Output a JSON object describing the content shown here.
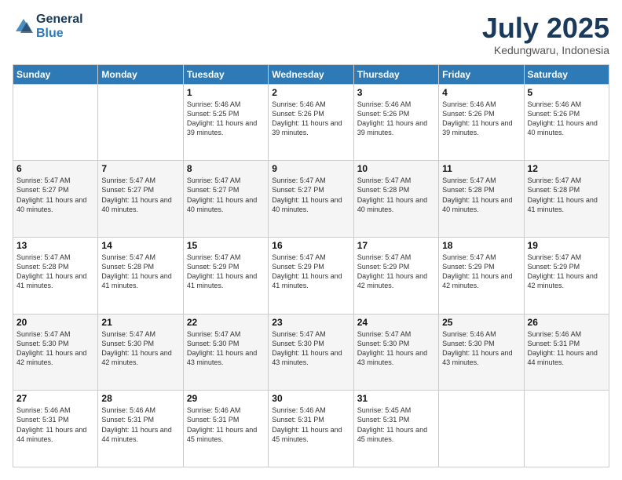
{
  "header": {
    "logo_line1": "General",
    "logo_line2": "Blue",
    "month": "July 2025",
    "location": "Kedungwaru, Indonesia"
  },
  "days_of_week": [
    "Sunday",
    "Monday",
    "Tuesday",
    "Wednesday",
    "Thursday",
    "Friday",
    "Saturday"
  ],
  "weeks": [
    [
      {
        "day": "",
        "info": ""
      },
      {
        "day": "",
        "info": ""
      },
      {
        "day": "1",
        "info": "Sunrise: 5:46 AM\nSunset: 5:25 PM\nDaylight: 11 hours and 39 minutes."
      },
      {
        "day": "2",
        "info": "Sunrise: 5:46 AM\nSunset: 5:26 PM\nDaylight: 11 hours and 39 minutes."
      },
      {
        "day": "3",
        "info": "Sunrise: 5:46 AM\nSunset: 5:26 PM\nDaylight: 11 hours and 39 minutes."
      },
      {
        "day": "4",
        "info": "Sunrise: 5:46 AM\nSunset: 5:26 PM\nDaylight: 11 hours and 39 minutes."
      },
      {
        "day": "5",
        "info": "Sunrise: 5:46 AM\nSunset: 5:26 PM\nDaylight: 11 hours and 40 minutes."
      }
    ],
    [
      {
        "day": "6",
        "info": "Sunrise: 5:47 AM\nSunset: 5:27 PM\nDaylight: 11 hours and 40 minutes."
      },
      {
        "day": "7",
        "info": "Sunrise: 5:47 AM\nSunset: 5:27 PM\nDaylight: 11 hours and 40 minutes."
      },
      {
        "day": "8",
        "info": "Sunrise: 5:47 AM\nSunset: 5:27 PM\nDaylight: 11 hours and 40 minutes."
      },
      {
        "day": "9",
        "info": "Sunrise: 5:47 AM\nSunset: 5:27 PM\nDaylight: 11 hours and 40 minutes."
      },
      {
        "day": "10",
        "info": "Sunrise: 5:47 AM\nSunset: 5:28 PM\nDaylight: 11 hours and 40 minutes."
      },
      {
        "day": "11",
        "info": "Sunrise: 5:47 AM\nSunset: 5:28 PM\nDaylight: 11 hours and 40 minutes."
      },
      {
        "day": "12",
        "info": "Sunrise: 5:47 AM\nSunset: 5:28 PM\nDaylight: 11 hours and 41 minutes."
      }
    ],
    [
      {
        "day": "13",
        "info": "Sunrise: 5:47 AM\nSunset: 5:28 PM\nDaylight: 11 hours and 41 minutes."
      },
      {
        "day": "14",
        "info": "Sunrise: 5:47 AM\nSunset: 5:28 PM\nDaylight: 11 hours and 41 minutes."
      },
      {
        "day": "15",
        "info": "Sunrise: 5:47 AM\nSunset: 5:29 PM\nDaylight: 11 hours and 41 minutes."
      },
      {
        "day": "16",
        "info": "Sunrise: 5:47 AM\nSunset: 5:29 PM\nDaylight: 11 hours and 41 minutes."
      },
      {
        "day": "17",
        "info": "Sunrise: 5:47 AM\nSunset: 5:29 PM\nDaylight: 11 hours and 42 minutes."
      },
      {
        "day": "18",
        "info": "Sunrise: 5:47 AM\nSunset: 5:29 PM\nDaylight: 11 hours and 42 minutes."
      },
      {
        "day": "19",
        "info": "Sunrise: 5:47 AM\nSunset: 5:29 PM\nDaylight: 11 hours and 42 minutes."
      }
    ],
    [
      {
        "day": "20",
        "info": "Sunrise: 5:47 AM\nSunset: 5:30 PM\nDaylight: 11 hours and 42 minutes."
      },
      {
        "day": "21",
        "info": "Sunrise: 5:47 AM\nSunset: 5:30 PM\nDaylight: 11 hours and 42 minutes."
      },
      {
        "day": "22",
        "info": "Sunrise: 5:47 AM\nSunset: 5:30 PM\nDaylight: 11 hours and 43 minutes."
      },
      {
        "day": "23",
        "info": "Sunrise: 5:47 AM\nSunset: 5:30 PM\nDaylight: 11 hours and 43 minutes."
      },
      {
        "day": "24",
        "info": "Sunrise: 5:47 AM\nSunset: 5:30 PM\nDaylight: 11 hours and 43 minutes."
      },
      {
        "day": "25",
        "info": "Sunrise: 5:46 AM\nSunset: 5:30 PM\nDaylight: 11 hours and 43 minutes."
      },
      {
        "day": "26",
        "info": "Sunrise: 5:46 AM\nSunset: 5:31 PM\nDaylight: 11 hours and 44 minutes."
      }
    ],
    [
      {
        "day": "27",
        "info": "Sunrise: 5:46 AM\nSunset: 5:31 PM\nDaylight: 11 hours and 44 minutes."
      },
      {
        "day": "28",
        "info": "Sunrise: 5:46 AM\nSunset: 5:31 PM\nDaylight: 11 hours and 44 minutes."
      },
      {
        "day": "29",
        "info": "Sunrise: 5:46 AM\nSunset: 5:31 PM\nDaylight: 11 hours and 45 minutes."
      },
      {
        "day": "30",
        "info": "Sunrise: 5:46 AM\nSunset: 5:31 PM\nDaylight: 11 hours and 45 minutes."
      },
      {
        "day": "31",
        "info": "Sunrise: 5:45 AM\nSunset: 5:31 PM\nDaylight: 11 hours and 45 minutes."
      },
      {
        "day": "",
        "info": ""
      },
      {
        "day": "",
        "info": ""
      }
    ]
  ]
}
